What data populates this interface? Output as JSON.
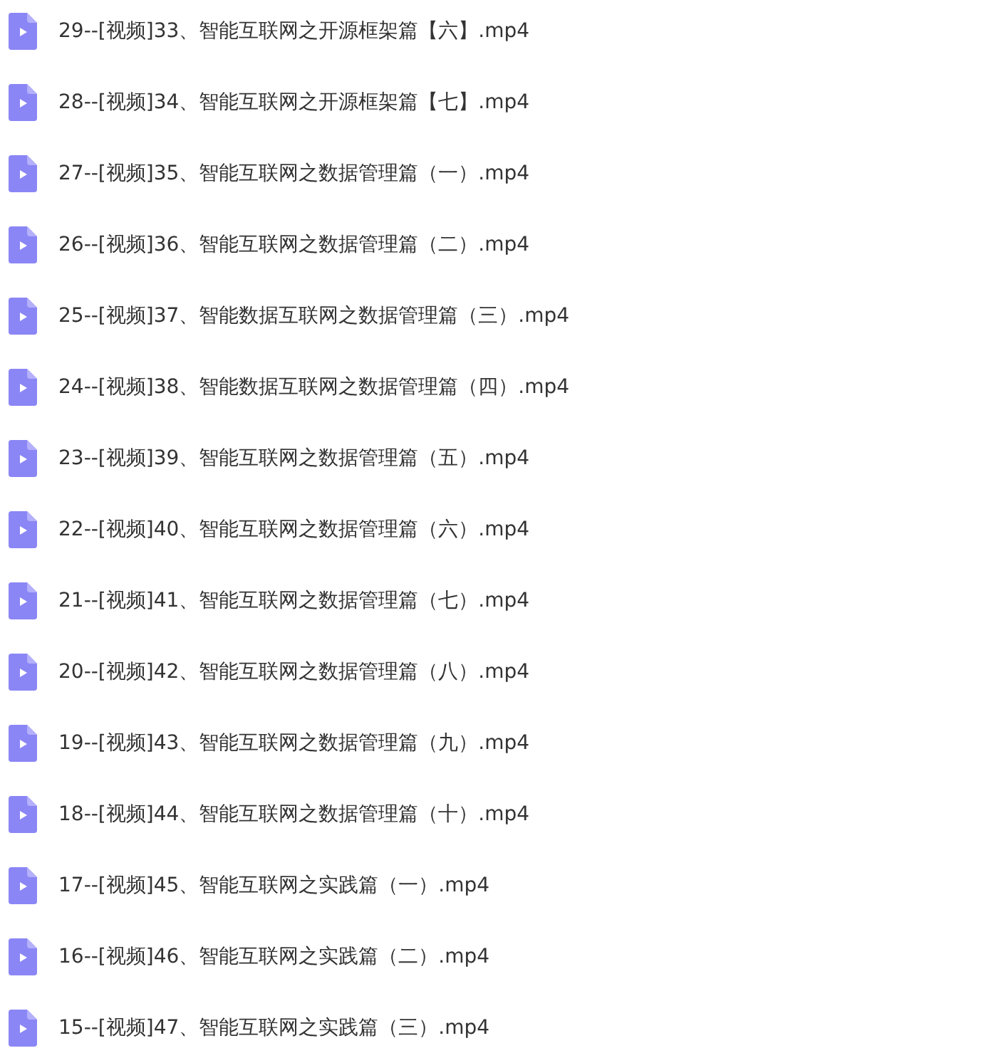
{
  "files": [
    {
      "name": "29--[视频]33、智能互联网之开源框架篇【六】.mp4"
    },
    {
      "name": "28--[视频]34、智能互联网之开源框架篇【七】.mp4"
    },
    {
      "name": "27--[视频]35、智能互联网之数据管理篇（一）.mp4"
    },
    {
      "name": "26--[视频]36、智能互联网之数据管理篇（二）.mp4"
    },
    {
      "name": "25--[视频]37、智能数据互联网之数据管理篇（三）.mp4"
    },
    {
      "name": "24--[视频]38、智能数据互联网之数据管理篇（四）.mp4"
    },
    {
      "name": "23--[视频]39、智能互联网之数据管理篇（五）.mp4"
    },
    {
      "name": "22--[视频]40、智能互联网之数据管理篇（六）.mp4"
    },
    {
      "name": "21--[视频]41、智能互联网之数据管理篇（七）.mp4"
    },
    {
      "name": "20--[视频]42、智能互联网之数据管理篇（八）.mp4"
    },
    {
      "name": "19--[视频]43、智能互联网之数据管理篇（九）.mp4"
    },
    {
      "name": "18--[视频]44、智能互联网之数据管理篇（十）.mp4"
    },
    {
      "name": "17--[视频]45、智能互联网之实践篇（一）.mp4"
    },
    {
      "name": "16--[视频]46、智能互联网之实践篇（二）.mp4"
    },
    {
      "name": "15--[视频]47、智能互联网之实践篇（三）.mp4"
    }
  ]
}
